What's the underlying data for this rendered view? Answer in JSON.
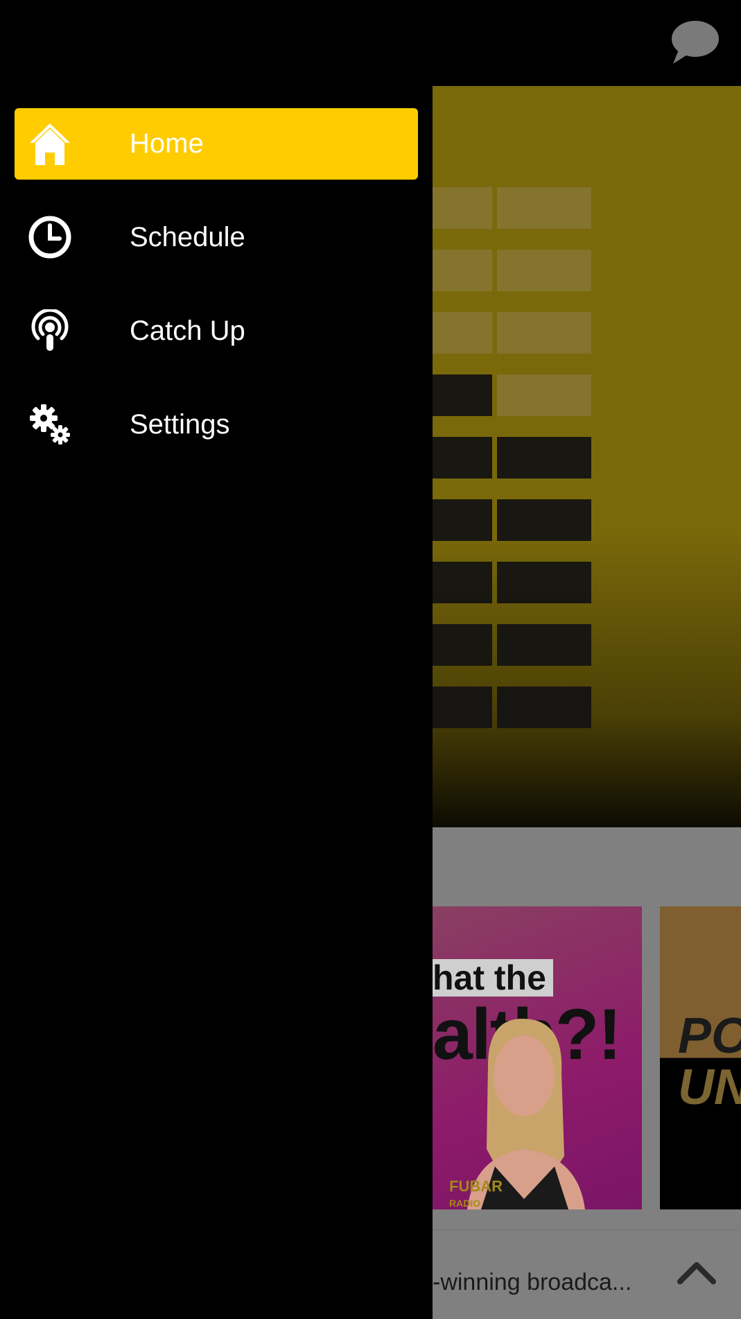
{
  "nav": {
    "items": [
      {
        "label": "Home",
        "icon": "home-icon",
        "active": true
      },
      {
        "label": "Schedule",
        "icon": "clock-icon",
        "active": false
      },
      {
        "label": "Catch Up",
        "icon": "podcast-icon",
        "active": false
      },
      {
        "label": "Settings",
        "icon": "gears-icon",
        "active": false
      }
    ]
  },
  "header": {
    "chat_icon": "chat-bubble-icon"
  },
  "cards": [
    {
      "headline_line1": "hat the",
      "headline_line2": "alth?!",
      "logo": "FUBAR",
      "logo_sub": "RADIO"
    },
    {
      "line1": "POI",
      "line2": "UNC"
    }
  ],
  "now_playing": {
    "text": "-winning broadca..."
  },
  "colors": {
    "accent": "#ffcc00",
    "drawer": "#000000",
    "hero": "#7a690a"
  }
}
